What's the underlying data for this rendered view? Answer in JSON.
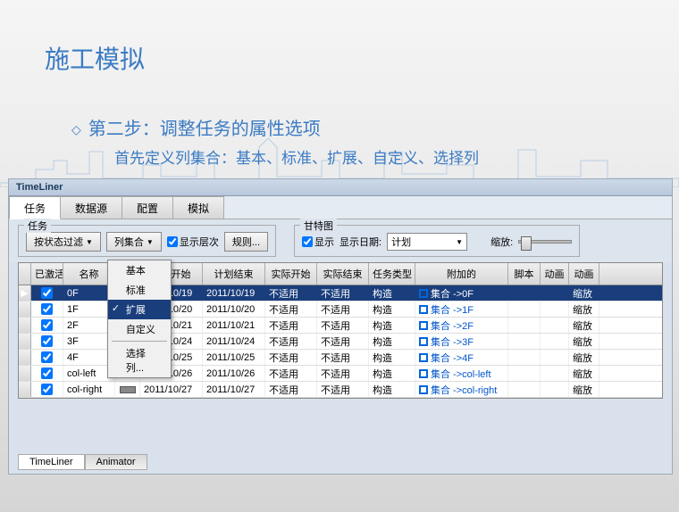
{
  "title": "施工模拟",
  "step": "第二步：调整任务的属性选项",
  "subtitle": "首先定义列集合：基本、标准、扩展、自定义、选择列",
  "panel_title": "TimeLiner",
  "tabs": {
    "task": "任务",
    "datasource": "数据源",
    "configure": "配置",
    "simulate": "模拟"
  },
  "toolbar": {
    "group1": "任务",
    "filter": "按状态过滤",
    "colset": "列集合",
    "showlevel": "显示层次",
    "rules": "规则...",
    "group2": "甘特图",
    "show": "显示",
    "showdate": "显示日期:",
    "plan": "计划",
    "zoom": "缩放:"
  },
  "dropdown": {
    "basic": "基本",
    "standard": "标准",
    "extend": "扩展",
    "custom": "自定义",
    "selcol": "选择列..."
  },
  "headers": {
    "active": "已激活",
    "name": "名称",
    "planstart": "计划开始",
    "planend": "计划结束",
    "actstart": "实际开始",
    "actend": "实际结束",
    "tasktype": "任务类型",
    "attached": "附加的",
    "script": "脚本",
    "anim": "动画",
    "anim2": "动画"
  },
  "rows": [
    {
      "name": "0F",
      "ps": "2011/10/19",
      "pe": "2011/10/19",
      "as": "不适用",
      "ae": "不适用",
      "tt": "构造",
      "att": "集合 ->0F",
      "a2": "缩放",
      "sel": true
    },
    {
      "name": "1F",
      "ps": "2011/10/20",
      "pe": "2011/10/20",
      "as": "不适用",
      "ae": "不适用",
      "tt": "构造",
      "att": "集合 ->1F",
      "a2": "缩放"
    },
    {
      "name": "2F",
      "ps": "2011/10/21",
      "pe": "2011/10/21",
      "as": "不适用",
      "ae": "不适用",
      "tt": "构造",
      "att": "集合 ->2F",
      "a2": "缩放"
    },
    {
      "name": "3F",
      "ps": "2011/10/24",
      "pe": "2011/10/24",
      "as": "不适用",
      "ae": "不适用",
      "tt": "构造",
      "att": "集合 ->3F",
      "a2": "缩放"
    },
    {
      "name": "4F",
      "ps": "2011/10/25",
      "pe": "2011/10/25",
      "as": "不适用",
      "ae": "不适用",
      "tt": "构造",
      "att": "集合 ->4F",
      "a2": "缩放"
    },
    {
      "name": "col-left",
      "ps": "2011/10/26",
      "pe": "2011/10/26",
      "as": "不适用",
      "ae": "不适用",
      "tt": "构造",
      "att": "集合 ->col-left",
      "a2": "缩放"
    },
    {
      "name": "col-right",
      "ps": "2011/10/27",
      "pe": "2011/10/27",
      "as": "不适用",
      "ae": "不适用",
      "tt": "构造",
      "att": "集合 ->col-right",
      "a2": "缩放"
    }
  ],
  "bottom_tabs": {
    "timeliner": "TimeLiner",
    "animator": "Animator"
  }
}
